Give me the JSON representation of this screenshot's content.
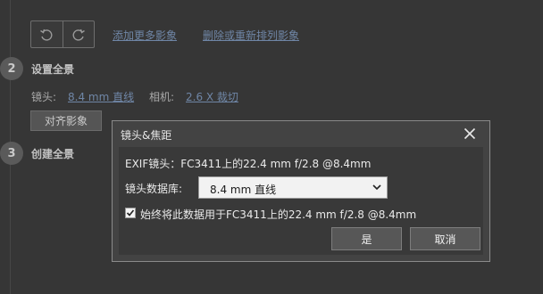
{
  "toolbar": {
    "undo_icon": "undo-icon",
    "redo_icon": "redo-icon",
    "add_images_link": "添加更多影象",
    "remove_reorder_link": "删除或重新排列影象"
  },
  "steps": {
    "step2": {
      "number": "2",
      "title": "设置全景",
      "lens_label": "镜头:",
      "lens_value": "8.4 mm 直线",
      "camera_label": "相机:",
      "camera_value": "2.6 X 裁切",
      "align_button": "对齐影象"
    },
    "step3": {
      "number": "3",
      "title": "创建全景"
    }
  },
  "dialog": {
    "title": "镜头&焦距",
    "close_icon": "close-icon",
    "exif_text": "EXIF镜头：FC3411上的22.4 mm f/2.8 @8.4mm",
    "lens_db_label": "镜头数据库:",
    "lens_db_value": "8.4 mm 直线",
    "always_use_text": "始终将此数据用于FC3411上的22.4 mm f/2.8 @8.4mm",
    "always_use_checked": true,
    "ok_button": "是",
    "cancel_button": "取消"
  },
  "colors": {
    "background": "#363636",
    "dialog_background": "#434343",
    "link": "#6f86a6"
  }
}
